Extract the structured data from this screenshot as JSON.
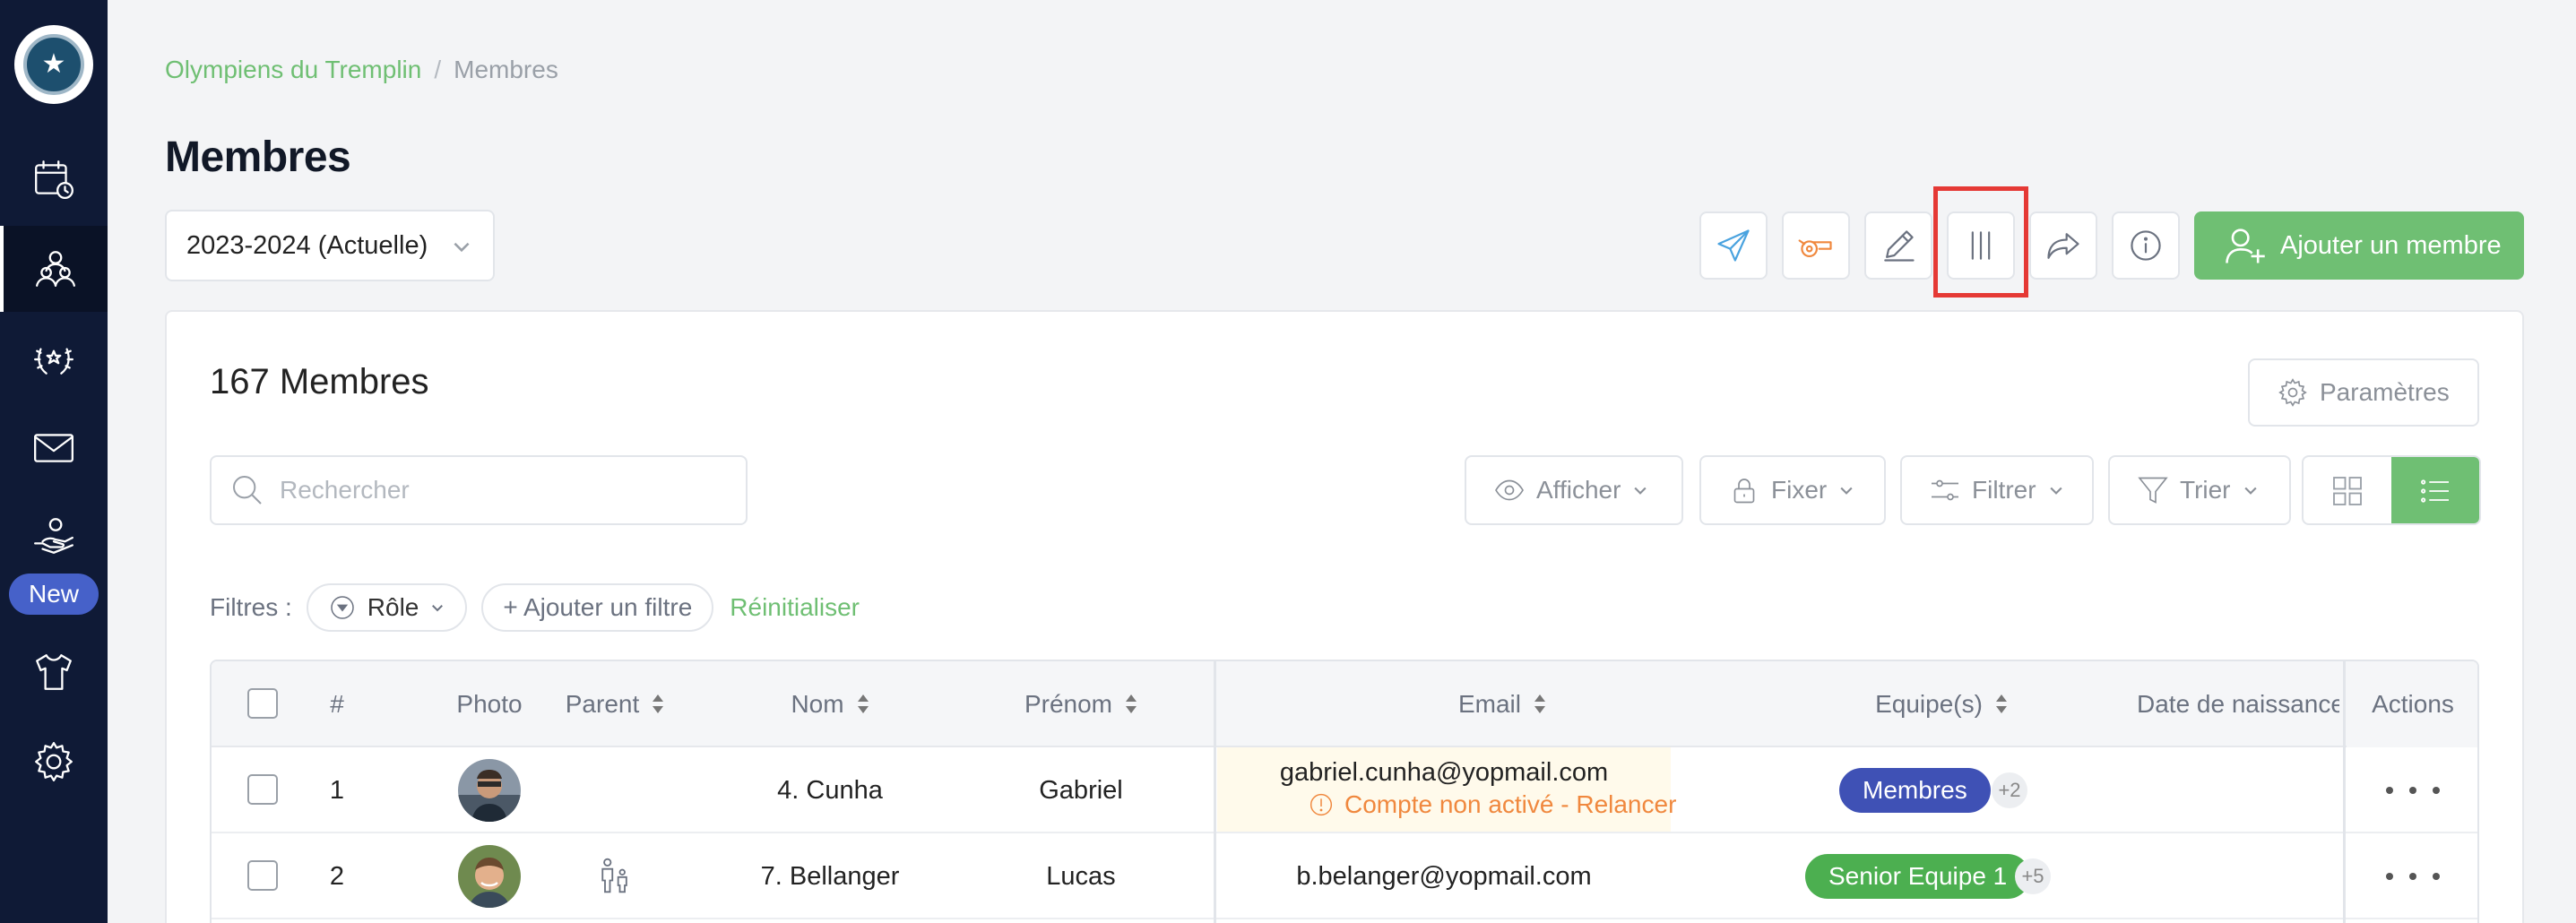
{
  "colors": {
    "accent": "#6fbf73",
    "sidebar": "#0f1a36",
    "new_badge": "#4661c9",
    "badge_members": "#3f51b5",
    "badge_senior": "#4caf50",
    "warning": "#f0883e",
    "highlight": "#e53935"
  },
  "sidebar": {
    "items": [
      {
        "icon": "calendar-clock-icon"
      },
      {
        "icon": "members-icon",
        "active": true
      },
      {
        "icon": "laurel-icon"
      },
      {
        "icon": "mail-icon"
      },
      {
        "icon": "hand-donation-icon"
      },
      {
        "icon": "jersey-icon"
      },
      {
        "icon": "gear-icon"
      }
    ],
    "new_badge": "New"
  },
  "breadcrumb": {
    "parent": "Olympiens du Tremplin",
    "separator": "/",
    "current": "Membres"
  },
  "page": {
    "title": "Membres"
  },
  "season_select": {
    "value": "2023-2024 (Actuelle)"
  },
  "toolbar": {
    "icons": [
      "send-icon",
      "whistle-icon",
      "pencil-icon",
      "columns-icon",
      "share-icon",
      "info-icon"
    ],
    "add_member_label": "Ajouter un membre"
  },
  "card": {
    "count_label": "167 Membres",
    "settings_label": "Paramètres",
    "search_placeholder": "Rechercher",
    "controls": {
      "afficher": "Afficher",
      "fixer": "Fixer",
      "filtrer": "Filtrer",
      "trier": "Trier"
    },
    "filters": {
      "label": "Filtres :",
      "role_chip": "Rôle",
      "add_filter": "+ Ajouter un filtre",
      "reset": "Réinitialiser"
    }
  },
  "table": {
    "columns": {
      "num": "#",
      "photo": "Photo",
      "parent": "Parent",
      "nom": "Nom",
      "prenom": "Prénom",
      "email": "Email",
      "equipes": "Equipe(s)",
      "date_naissance": "Date de naissance",
      "actions": "Actions"
    },
    "rows": [
      {
        "num": "1",
        "nom": "4. Cunha",
        "prenom": "Gabriel",
        "email": "gabriel.cunha@yopmail.com",
        "warning": "Compte non activé - Relancer",
        "team": "Membres",
        "more": "+2",
        "has_parent": false
      },
      {
        "num": "2",
        "nom": "7. Bellanger",
        "prenom": "Lucas",
        "email": "b.belanger@yopmail.com",
        "warning": "",
        "team": "Senior Equipe 1",
        "more": "+5",
        "has_parent": true
      }
    ]
  }
}
